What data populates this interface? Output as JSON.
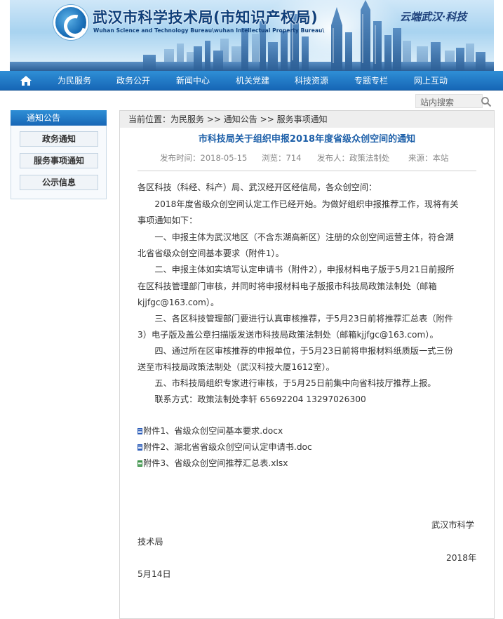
{
  "header": {
    "title": "武汉市科学技术局(市知识产权局)",
    "subtitle": "Wuhan Science and Technology Bureau\\wuhan Intellectual Property Bureau\\",
    "slogan": "云端武汉·科技"
  },
  "nav": {
    "items": [
      "为民服务",
      "政务公开",
      "新闻中心",
      "机关党建",
      "科技资源",
      "专题专栏",
      "网上互动"
    ]
  },
  "search": {
    "label": "站内搜索"
  },
  "sidebar": {
    "title": "通知公告",
    "items": [
      "政务通知",
      "服务事项通知",
      "公示信息"
    ]
  },
  "breadcrumb": {
    "prefix": "当前位置：",
    "parts": [
      "为民服务",
      "通知公告",
      "服务事项通知"
    ],
    "sep": ">>"
  },
  "article": {
    "title": "市科技局关于组织申报2018年度省级众创空间的通知",
    "meta": {
      "date": "发布时间：2018-05-15",
      "views": "浏览：714",
      "publisher": "发布人：政策法制处",
      "source": "来源：本站"
    },
    "lines": [
      "各区科技（科经、科产）局、武汉经开区经信局，各众创空间：",
      "　　2018年度省级众创空间认定工作已经开始。为做好组织申报推荐工作，现将有关",
      "事项通知如下：",
      "　　一、申报主体为武汉地区（不含东湖高新区）注册的众创空间运营主体，符合湖",
      "北省省级众创空间基本要求（附件1）。",
      "　　二、申报主体如实填写认定申请书（附件2），申报材料电子版于5月21日前报所",
      "在区科技管理部门审核，并同时将申报材料电子版报市科技局政策法制处（邮箱",
      "kjjfgc@163.com）。",
      "　　三、各区科技管理部门要进行认真审核推荐，于5月23日前将推荐汇总表（附件",
      "3）电子版及盖公章扫描版发送市科技局政策法制处（邮箱kjjfgc@163.com）。",
      "　　四、通过所在区审核推荐的申报单位，于5月23日前将申报材料纸质版一式三份",
      "送至市科技局政策法制处（武汉科技大厦1612室）。",
      "　　五、市科技局组织专家进行审核，于5月25日前集中向省科技厅推荐上报。",
      "　　联系方式：政策法制处李轩 65692204 13297026300"
    ],
    "attachments": [
      "附件1、省级众创空间基本要求.docx",
      "附件2、湖北省省级众创空间认定申请书.doc",
      "附件3、省级众创空间推荐汇总表.xlsx"
    ],
    "signature": {
      "org_line1": "武汉市科学",
      "org_line2": "技术局",
      "date_line1": "2018年",
      "date_line2": "5月14日"
    }
  }
}
